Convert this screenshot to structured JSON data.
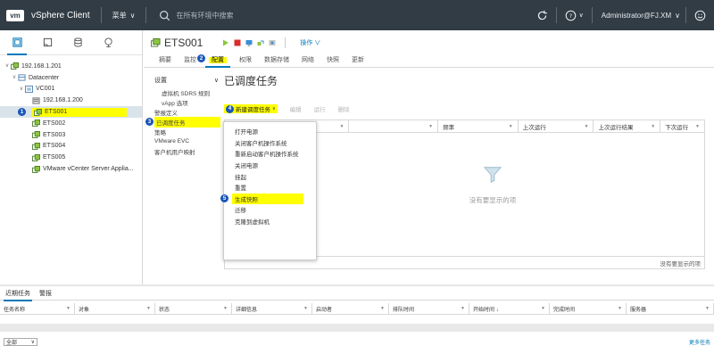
{
  "topbar": {
    "logo": "vm",
    "app_name": "vSphere Client",
    "menu": "菜单",
    "search_placeholder": "在所有环境中搜索",
    "user": "Administrator@FJ.XM"
  },
  "navigator": {
    "tabs": [
      "hosts-clusters-icon",
      "vms-templates-icon",
      "storage-icon",
      "networking-icon"
    ],
    "tree": [
      {
        "label": "192.168.1.201",
        "depth": 0,
        "icon": "vcenter-icon",
        "chev": "v"
      },
      {
        "label": "Datacenter",
        "depth": 1,
        "icon": "datacenter-icon",
        "chev": "v"
      },
      {
        "label": "VC001",
        "depth": 2,
        "icon": "cluster-icon",
        "chev": "v"
      },
      {
        "label": "192.168.1.200",
        "depth": 3,
        "icon": "host-icon",
        "chev": ""
      },
      {
        "label": "ETS001",
        "depth": 3,
        "icon": "vm-icon",
        "chev": "",
        "selected": true,
        "badge": "1"
      },
      {
        "label": "ETS002",
        "depth": 3,
        "icon": "vm-icon",
        "chev": ""
      },
      {
        "label": "ETS003",
        "depth": 3,
        "icon": "vm-icon",
        "chev": ""
      },
      {
        "label": "ETS004",
        "depth": 3,
        "icon": "vm-icon",
        "chev": ""
      },
      {
        "label": "ETS005",
        "depth": 3,
        "icon": "vm-icon",
        "chev": ""
      },
      {
        "label": "VMware vCenter Server Applia...",
        "depth": 3,
        "icon": "vm-icon",
        "chev": ""
      }
    ]
  },
  "object": {
    "title": "ETS001",
    "actions": "操作 ∨"
  },
  "tabs": [
    {
      "label": "摘要"
    },
    {
      "label": "监控"
    },
    {
      "label": "配置",
      "active": true,
      "badge": "2"
    },
    {
      "label": "权限"
    },
    {
      "label": "数据存储"
    },
    {
      "label": "网络"
    },
    {
      "label": "快照"
    },
    {
      "label": "更新"
    }
  ],
  "settings": {
    "header": "设置",
    "items": [
      {
        "label": "虚拟机 SDRS 规则",
        "sub": true
      },
      {
        "label": "vApp 选项",
        "sub": true
      },
      {
        "label": "警报定义",
        "sub": false
      },
      {
        "label": "已调度任务",
        "sub": false,
        "selected": true,
        "badge": "3"
      },
      {
        "label": "策略",
        "sub": false
      },
      {
        "label": "VMware EVC",
        "sub": false
      },
      {
        "label": "客户机用户映射",
        "sub": false
      }
    ]
  },
  "content": {
    "title": "已调度任务",
    "toolbar": {
      "new_task": "新建调度任务",
      "edit": "编辑",
      "run": "运行",
      "delete": "删除",
      "badge": "4"
    },
    "columns": [
      "",
      "",
      "频率",
      "上次运行",
      "上次运行结果",
      "下次运行"
    ],
    "empty_text": "没有要显示的项",
    "footer": "没有要显示的项"
  },
  "dropdown": {
    "items": [
      "打开电源",
      "关闭客户机操作系统",
      "重新启动客户机操作系统",
      "关闭电源",
      "挂起",
      "重置",
      "生成快照",
      "迁移",
      "克隆到虚拟机"
    ],
    "highlight_index": 6,
    "badge": "5"
  },
  "bottom": {
    "tabs": [
      "近期任务",
      "警报"
    ],
    "columns": [
      "任务名称",
      "对象",
      "状态",
      "详细信息",
      "启动者",
      "排队时间",
      "开始时间 ↓",
      "完成时间",
      "服务器"
    ],
    "filter": "全部",
    "more": "更多任务"
  }
}
